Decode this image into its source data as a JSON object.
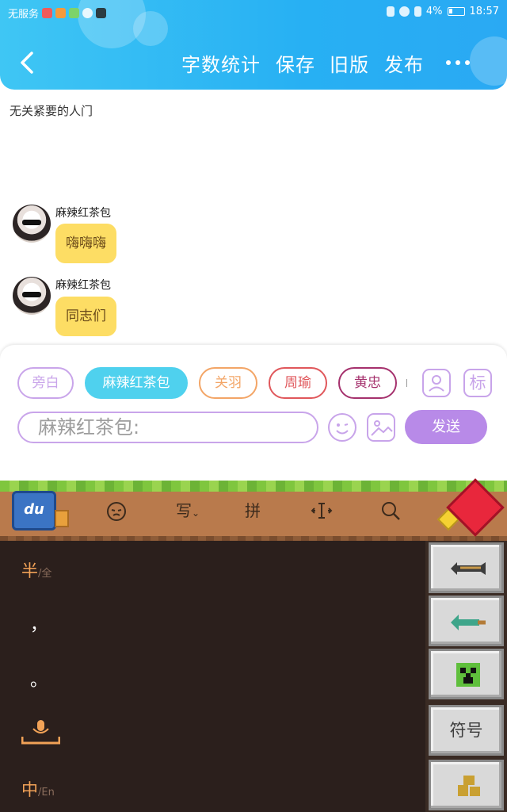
{
  "status_bar": {
    "carrier": "无服务",
    "battery_percent": "4%",
    "time": "18:57"
  },
  "header": {
    "buttons": [
      "字数统计",
      "保存",
      "旧版",
      "发布"
    ]
  },
  "document": {
    "title": "无关紧要的人门"
  },
  "messages": [
    {
      "sender": "麻辣红茶包",
      "text": "嗨嗨嗨"
    },
    {
      "sender": "麻辣红茶包",
      "text": "同志们"
    }
  ],
  "roles": [
    {
      "label": "旁白",
      "color": "#c9a5ea",
      "active": false
    },
    {
      "label": "麻辣红茶包",
      "color": "#4fd1ee",
      "active": true
    },
    {
      "label": "关羽",
      "color": "#f3a566",
      "active": false
    },
    {
      "label": "周瑜",
      "color": "#e0575b",
      "active": false
    },
    {
      "label": "黄忠",
      "color": "#a5316d",
      "active": false
    }
  ],
  "input": {
    "placeholder": "麻辣红茶包:",
    "send_label": "发送",
    "biao_label": "标"
  },
  "keyboard": {
    "logo_text": "du",
    "toolbar": {
      "write": "写",
      "pinyin": "拼"
    },
    "left_column": {
      "half_label": "半",
      "half_alt": "/全",
      "comma": "，",
      "period": "。",
      "lang_label": "中",
      "lang_alt": "/En"
    },
    "right_column": {
      "symbol_label": "符号"
    }
  }
}
